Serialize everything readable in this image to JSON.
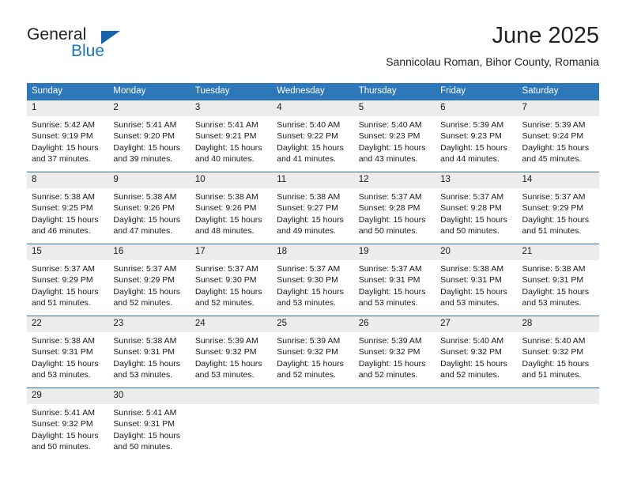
{
  "brand": {
    "name_part1": "General",
    "name_part2": "Blue",
    "accent_color": "#1b75bb",
    "triangle_color": "#1663ab"
  },
  "header": {
    "month_title": "June 2025",
    "location": "Sannicolau Roman, Bihor County, Romania"
  },
  "theme": {
    "header_bg": "#2e77b8",
    "row_divider": "#2e6da4",
    "daynum_bg": "#ececec",
    "text": "#1a1a1a"
  },
  "weekday_headers": [
    "Sunday",
    "Monday",
    "Tuesday",
    "Wednesday",
    "Thursday",
    "Friday",
    "Saturday"
  ],
  "weeks": [
    [
      {
        "day": "1",
        "sunrise": "Sunrise: 5:42 AM",
        "sunset": "Sunset: 9:19 PM",
        "daylight1": "Daylight: 15 hours",
        "daylight2": "and 37 minutes."
      },
      {
        "day": "2",
        "sunrise": "Sunrise: 5:41 AM",
        "sunset": "Sunset: 9:20 PM",
        "daylight1": "Daylight: 15 hours",
        "daylight2": "and 39 minutes."
      },
      {
        "day": "3",
        "sunrise": "Sunrise: 5:41 AM",
        "sunset": "Sunset: 9:21 PM",
        "daylight1": "Daylight: 15 hours",
        "daylight2": "and 40 minutes."
      },
      {
        "day": "4",
        "sunrise": "Sunrise: 5:40 AM",
        "sunset": "Sunset: 9:22 PM",
        "daylight1": "Daylight: 15 hours",
        "daylight2": "and 41 minutes."
      },
      {
        "day": "5",
        "sunrise": "Sunrise: 5:40 AM",
        "sunset": "Sunset: 9:23 PM",
        "daylight1": "Daylight: 15 hours",
        "daylight2": "and 43 minutes."
      },
      {
        "day": "6",
        "sunrise": "Sunrise: 5:39 AM",
        "sunset": "Sunset: 9:23 PM",
        "daylight1": "Daylight: 15 hours",
        "daylight2": "and 44 minutes."
      },
      {
        "day": "7",
        "sunrise": "Sunrise: 5:39 AM",
        "sunset": "Sunset: 9:24 PM",
        "daylight1": "Daylight: 15 hours",
        "daylight2": "and 45 minutes."
      }
    ],
    [
      {
        "day": "8",
        "sunrise": "Sunrise: 5:38 AM",
        "sunset": "Sunset: 9:25 PM",
        "daylight1": "Daylight: 15 hours",
        "daylight2": "and 46 minutes."
      },
      {
        "day": "9",
        "sunrise": "Sunrise: 5:38 AM",
        "sunset": "Sunset: 9:26 PM",
        "daylight1": "Daylight: 15 hours",
        "daylight2": "and 47 minutes."
      },
      {
        "day": "10",
        "sunrise": "Sunrise: 5:38 AM",
        "sunset": "Sunset: 9:26 PM",
        "daylight1": "Daylight: 15 hours",
        "daylight2": "and 48 minutes."
      },
      {
        "day": "11",
        "sunrise": "Sunrise: 5:38 AM",
        "sunset": "Sunset: 9:27 PM",
        "daylight1": "Daylight: 15 hours",
        "daylight2": "and 49 minutes."
      },
      {
        "day": "12",
        "sunrise": "Sunrise: 5:37 AM",
        "sunset": "Sunset: 9:28 PM",
        "daylight1": "Daylight: 15 hours",
        "daylight2": "and 50 minutes."
      },
      {
        "day": "13",
        "sunrise": "Sunrise: 5:37 AM",
        "sunset": "Sunset: 9:28 PM",
        "daylight1": "Daylight: 15 hours",
        "daylight2": "and 50 minutes."
      },
      {
        "day": "14",
        "sunrise": "Sunrise: 5:37 AM",
        "sunset": "Sunset: 9:29 PM",
        "daylight1": "Daylight: 15 hours",
        "daylight2": "and 51 minutes."
      }
    ],
    [
      {
        "day": "15",
        "sunrise": "Sunrise: 5:37 AM",
        "sunset": "Sunset: 9:29 PM",
        "daylight1": "Daylight: 15 hours",
        "daylight2": "and 51 minutes."
      },
      {
        "day": "16",
        "sunrise": "Sunrise: 5:37 AM",
        "sunset": "Sunset: 9:29 PM",
        "daylight1": "Daylight: 15 hours",
        "daylight2": "and 52 minutes."
      },
      {
        "day": "17",
        "sunrise": "Sunrise: 5:37 AM",
        "sunset": "Sunset: 9:30 PM",
        "daylight1": "Daylight: 15 hours",
        "daylight2": "and 52 minutes."
      },
      {
        "day": "18",
        "sunrise": "Sunrise: 5:37 AM",
        "sunset": "Sunset: 9:30 PM",
        "daylight1": "Daylight: 15 hours",
        "daylight2": "and 53 minutes."
      },
      {
        "day": "19",
        "sunrise": "Sunrise: 5:37 AM",
        "sunset": "Sunset: 9:31 PM",
        "daylight1": "Daylight: 15 hours",
        "daylight2": "and 53 minutes."
      },
      {
        "day": "20",
        "sunrise": "Sunrise: 5:38 AM",
        "sunset": "Sunset: 9:31 PM",
        "daylight1": "Daylight: 15 hours",
        "daylight2": "and 53 minutes."
      },
      {
        "day": "21",
        "sunrise": "Sunrise: 5:38 AM",
        "sunset": "Sunset: 9:31 PM",
        "daylight1": "Daylight: 15 hours",
        "daylight2": "and 53 minutes."
      }
    ],
    [
      {
        "day": "22",
        "sunrise": "Sunrise: 5:38 AM",
        "sunset": "Sunset: 9:31 PM",
        "daylight1": "Daylight: 15 hours",
        "daylight2": "and 53 minutes."
      },
      {
        "day": "23",
        "sunrise": "Sunrise: 5:38 AM",
        "sunset": "Sunset: 9:31 PM",
        "daylight1": "Daylight: 15 hours",
        "daylight2": "and 53 minutes."
      },
      {
        "day": "24",
        "sunrise": "Sunrise: 5:39 AM",
        "sunset": "Sunset: 9:32 PM",
        "daylight1": "Daylight: 15 hours",
        "daylight2": "and 53 minutes."
      },
      {
        "day": "25",
        "sunrise": "Sunrise: 5:39 AM",
        "sunset": "Sunset: 9:32 PM",
        "daylight1": "Daylight: 15 hours",
        "daylight2": "and 52 minutes."
      },
      {
        "day": "26",
        "sunrise": "Sunrise: 5:39 AM",
        "sunset": "Sunset: 9:32 PM",
        "daylight1": "Daylight: 15 hours",
        "daylight2": "and 52 minutes."
      },
      {
        "day": "27",
        "sunrise": "Sunrise: 5:40 AM",
        "sunset": "Sunset: 9:32 PM",
        "daylight1": "Daylight: 15 hours",
        "daylight2": "and 52 minutes."
      },
      {
        "day": "28",
        "sunrise": "Sunrise: 5:40 AM",
        "sunset": "Sunset: 9:32 PM",
        "daylight1": "Daylight: 15 hours",
        "daylight2": "and 51 minutes."
      }
    ],
    [
      {
        "day": "29",
        "sunrise": "Sunrise: 5:41 AM",
        "sunset": "Sunset: 9:32 PM",
        "daylight1": "Daylight: 15 hours",
        "daylight2": "and 50 minutes."
      },
      {
        "day": "30",
        "sunrise": "Sunrise: 5:41 AM",
        "sunset": "Sunset: 9:31 PM",
        "daylight1": "Daylight: 15 hours",
        "daylight2": "and 50 minutes."
      },
      {
        "day": "",
        "sunrise": "",
        "sunset": "",
        "daylight1": "",
        "daylight2": ""
      },
      {
        "day": "",
        "sunrise": "",
        "sunset": "",
        "daylight1": "",
        "daylight2": ""
      },
      {
        "day": "",
        "sunrise": "",
        "sunset": "",
        "daylight1": "",
        "daylight2": ""
      },
      {
        "day": "",
        "sunrise": "",
        "sunset": "",
        "daylight1": "",
        "daylight2": ""
      },
      {
        "day": "",
        "sunrise": "",
        "sunset": "",
        "daylight1": "",
        "daylight2": ""
      }
    ]
  ]
}
